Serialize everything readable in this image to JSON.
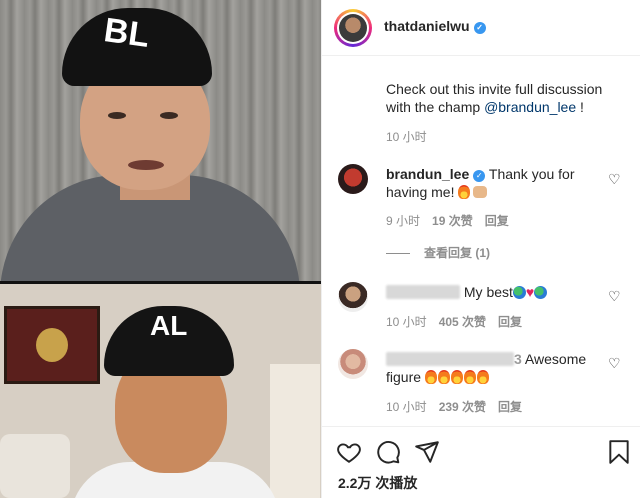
{
  "post": {
    "username": "thatdaniel wu",
    "username_display": "thatdanielwu",
    "caption_text": "Check out this invite full discussion with the champ ",
    "caption_mention": "@brandun_lee",
    "caption_end": " !",
    "caption_time": "10 小时"
  },
  "comments": [
    {
      "username": "brandun_lee",
      "text": "Thank you for having me!",
      "time": "9 小时",
      "likes": "19 次赞",
      "reply": "回复"
    },
    {
      "username": "",
      "text": "My best",
      "time": "10 小时",
      "likes": "405 次赞",
      "reply": "回复"
    },
    {
      "username": "",
      "username_tail": "3",
      "text": "Awesome figure",
      "time": "10 小时",
      "likes": "239 次赞",
      "reply": "回复"
    }
  ],
  "view_replies": "查看回复 (1)",
  "stats": {
    "plays": "2.2万 次播放"
  },
  "media": {
    "top_cap_text": "BL",
    "bottom_cap_text": "AL"
  },
  "icons": [
    "heart-icon",
    "comment-icon",
    "share-icon",
    "bookmark-icon",
    "verified-badge-icon"
  ],
  "colors": {
    "verified": "#3897f0",
    "mention": "#00376b",
    "secondary_text": "#8e8e8e",
    "divider": "#efefef"
  }
}
